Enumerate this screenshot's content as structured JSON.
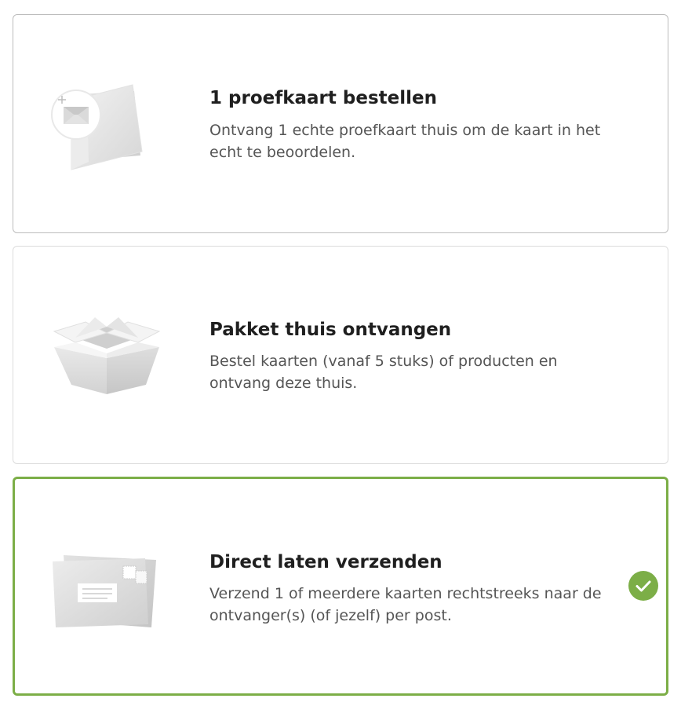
{
  "options": [
    {
      "title": "1 proefkaart bestellen",
      "description": "Ontvang 1 echte proefkaart thuis om de kaart in het echt te beoordelen.",
      "icon": "sample-card-icon",
      "selected": false
    },
    {
      "title": "Pakket thuis ontvangen",
      "description": "Bestel kaarten (vanaf 5 stuks) of producten en ontvang deze thuis.",
      "icon": "open-box-icon",
      "selected": false
    },
    {
      "title": "Direct laten verzenden",
      "description": "Verzend 1 of meerdere kaarten rechtstreeks naar de ontvanger(s) (of jezelf) per post.",
      "icon": "envelopes-icon",
      "selected": true
    }
  ],
  "colors": {
    "accent": "#7cae47",
    "title": "#1f1f1f",
    "description": "#555555",
    "border": "#cfcfcf"
  }
}
